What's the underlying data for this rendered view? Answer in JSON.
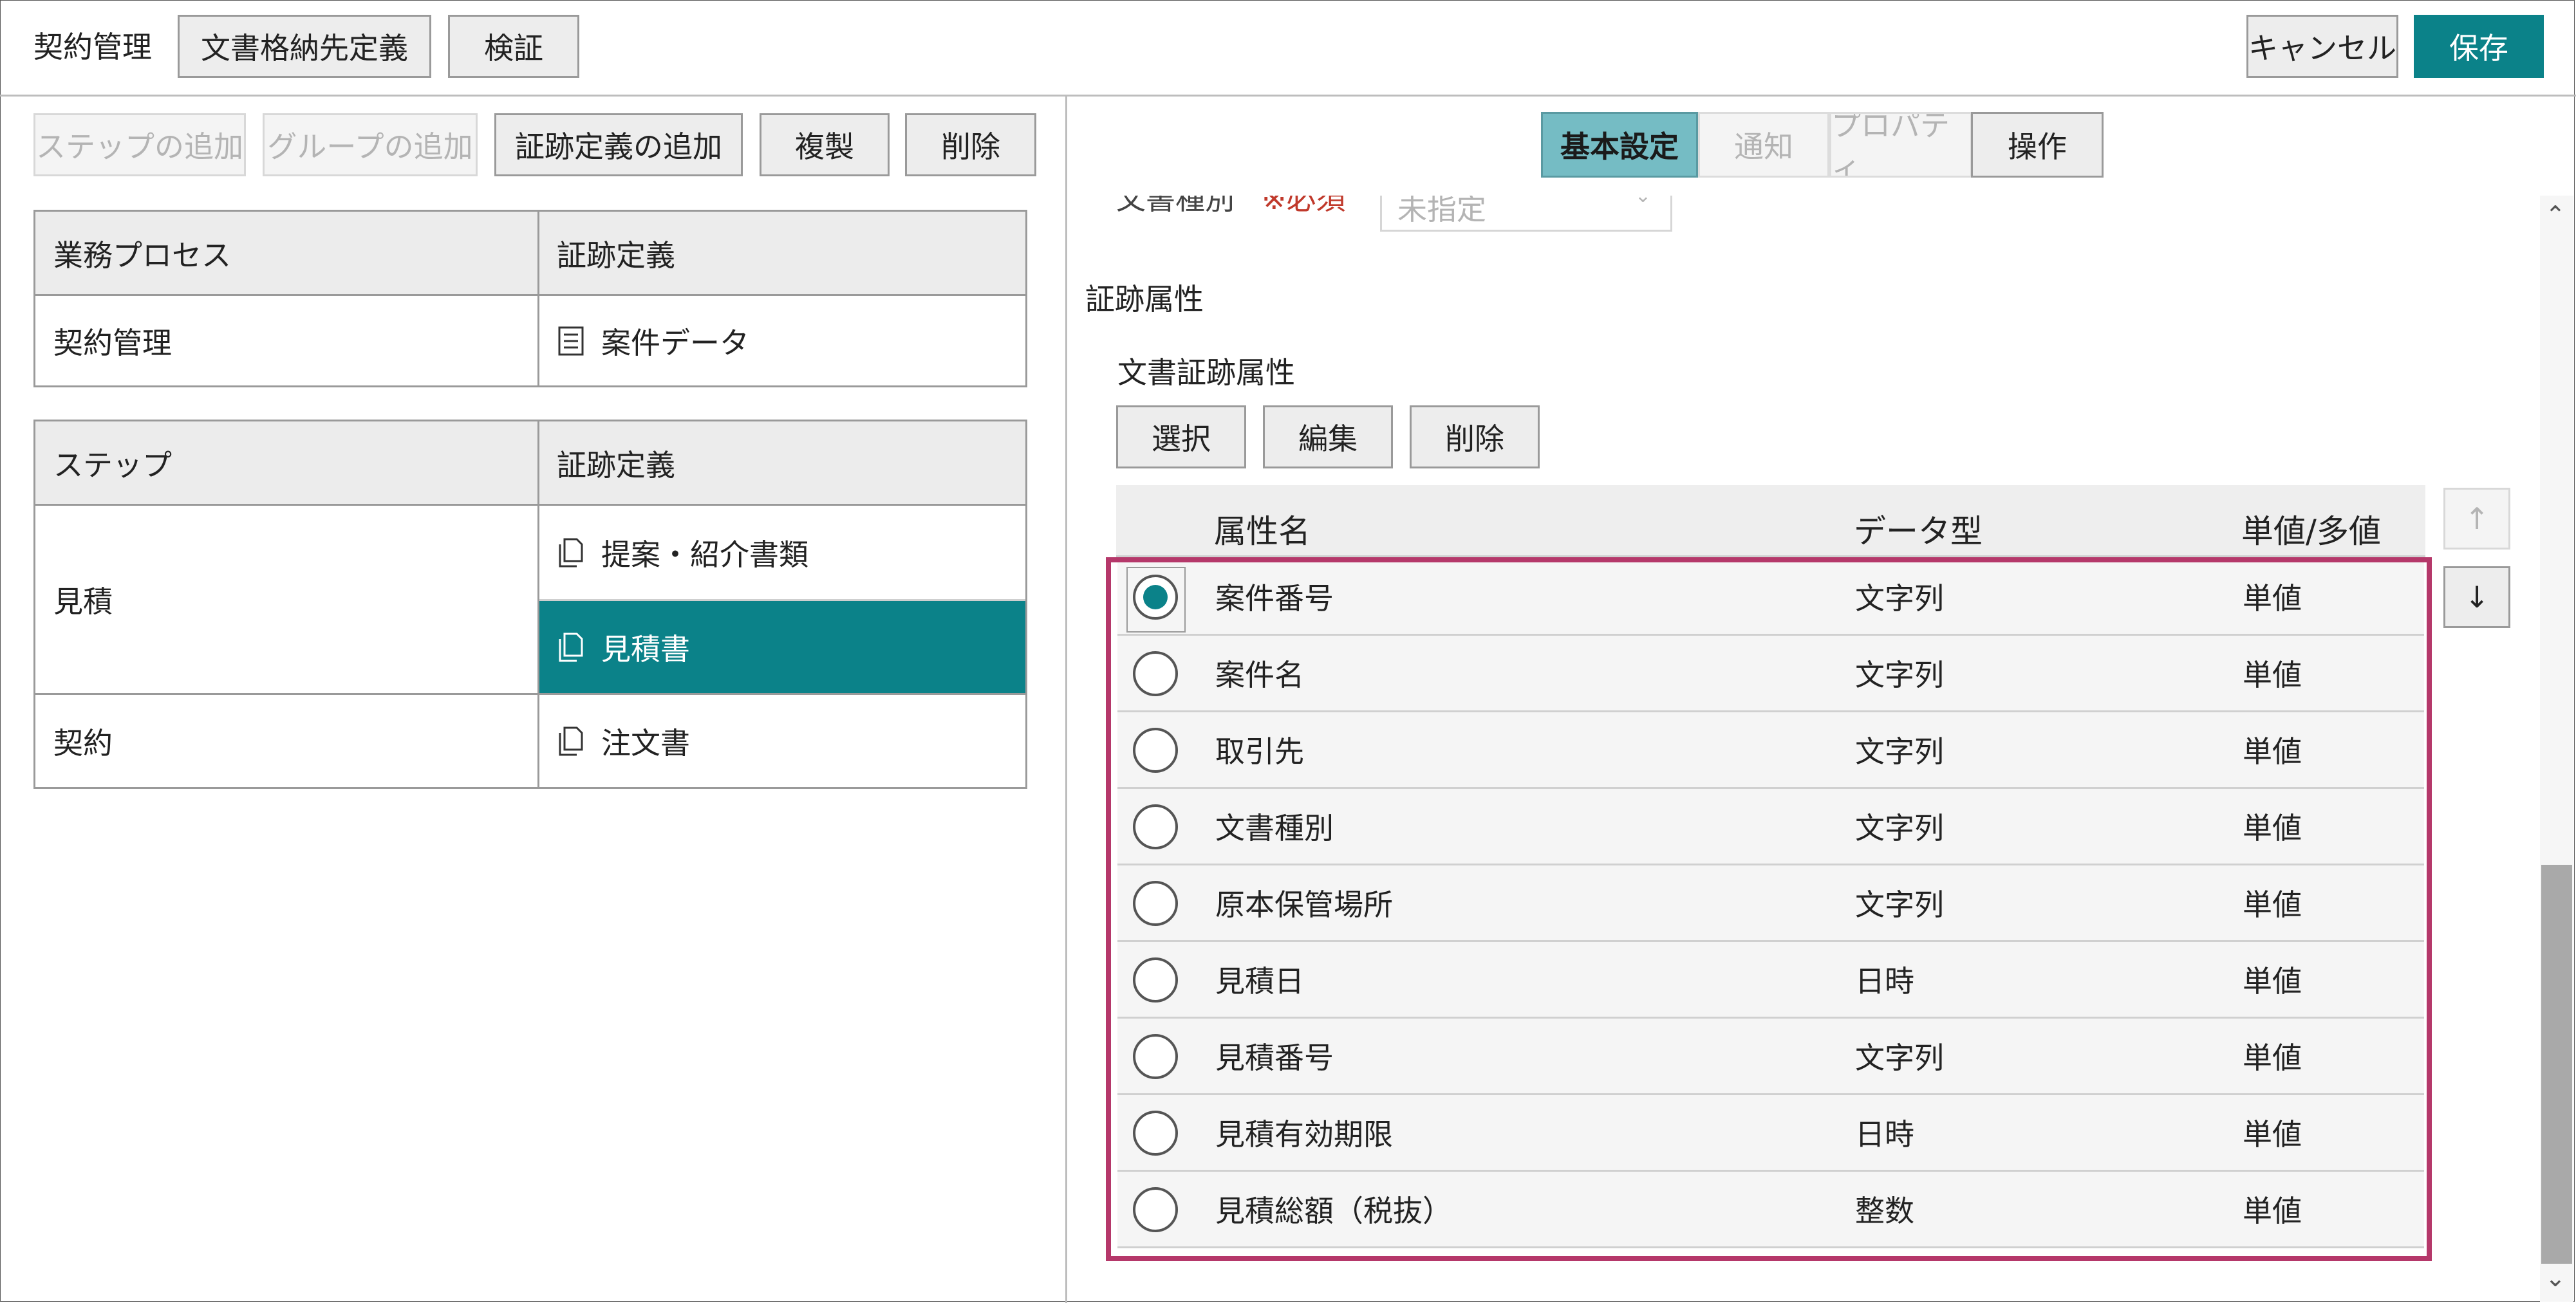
{
  "header": {
    "title": "契約管理",
    "doc_storage_btn": "文書格納先定義",
    "verify_btn": "検証",
    "cancel_btn": "キャンセル",
    "save_btn": "保存"
  },
  "left_toolbar": {
    "add_step": "ステップの追加",
    "add_group": "グループの追加",
    "add_trail_def": "証跡定義の追加",
    "duplicate": "複製",
    "delete": "削除"
  },
  "process_table": {
    "headers": [
      "業務プロセス",
      "証跡定義"
    ],
    "row": {
      "process": "契約管理",
      "definition": "案件データ"
    }
  },
  "step_table": {
    "headers": [
      "ステップ",
      "証跡定義"
    ],
    "steps": [
      {
        "name": "見積",
        "definitions": [
          "提案・紹介書類",
          "見積書"
        ]
      },
      {
        "name": "契約",
        "definitions": [
          "注文書"
        ]
      }
    ]
  },
  "tabs": [
    "基本設定",
    "通知",
    "プロパティ",
    "操作"
  ],
  "right_panel": {
    "partial_label": "文書種別",
    "partial_required": "※必須",
    "partial_select": "未指定",
    "section_title": "証跡属性",
    "subsection_title": "文書証跡属性",
    "select_btn": "選択",
    "edit_btn": "編集",
    "delete_btn": "削除",
    "columns": [
      "属性名",
      "データ型",
      "単値/多値"
    ],
    "rows": [
      {
        "name": "案件番号",
        "type": "文字列",
        "mult": "単値",
        "selected": true
      },
      {
        "name": "案件名",
        "type": "文字列",
        "mult": "単値",
        "selected": false
      },
      {
        "name": "取引先",
        "type": "文字列",
        "mult": "単値",
        "selected": false
      },
      {
        "name": "文書種別",
        "type": "文字列",
        "mult": "単値",
        "selected": false
      },
      {
        "name": "原本保管場所",
        "type": "文字列",
        "mult": "単値",
        "selected": false
      },
      {
        "name": "見積日",
        "type": "日時",
        "mult": "単値",
        "selected": false
      },
      {
        "name": "見積番号",
        "type": "文字列",
        "mult": "単値",
        "selected": false
      },
      {
        "name": "見積有効期限",
        "type": "日時",
        "mult": "単値",
        "selected": false
      },
      {
        "name": "見積総額（税抜）",
        "type": "整数",
        "mult": "単値",
        "selected": false
      }
    ],
    "move_up_glyph": "↑",
    "move_down_glyph": "↓"
  },
  "colors": {
    "accent": "#0b8289",
    "highlight_border": "#b5386a"
  }
}
